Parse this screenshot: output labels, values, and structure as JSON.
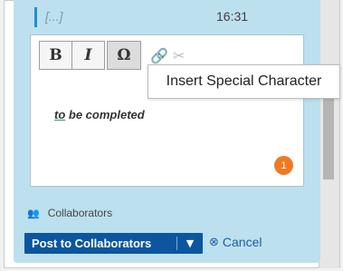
{
  "comment": {
    "placeholder_text": "[...]",
    "time": "16:31"
  },
  "toolbar": {
    "bold_label": "B",
    "italic_label": "I",
    "special_char_label": "Ω",
    "link_icon": "🔗",
    "unlink_icon": "✂"
  },
  "tooltip": {
    "text": "Insert Special Character"
  },
  "editor": {
    "text_underlined": "to",
    "text_rest": " be completed",
    "badge_count": "1"
  },
  "collaborators": {
    "icon": "👥",
    "label": "Collaborators"
  },
  "actions": {
    "post_label": "Post to Collaborators",
    "dropdown_arrow": "▼",
    "cancel_icon": "⊗",
    "cancel_label": "Cancel"
  }
}
